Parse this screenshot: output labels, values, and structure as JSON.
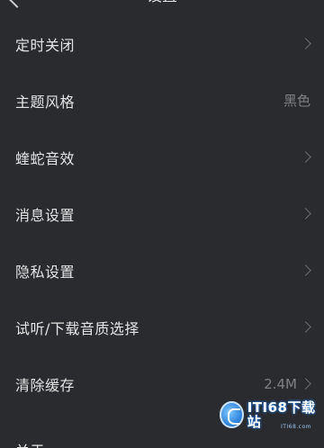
{
  "header": {
    "title": "设置",
    "back_icon": "chevron-left-icon"
  },
  "settings": {
    "items": [
      {
        "label": "定时关闭",
        "value": "",
        "icon": "chevron-right-icon"
      },
      {
        "label": "主题风格",
        "value": "黑色"
      },
      {
        "label": "蝰蛇音效",
        "value": "",
        "icon": "chevron-right-icon"
      },
      {
        "label": "消息设置",
        "value": "",
        "icon": "chevron-right-icon"
      },
      {
        "label": "隐私设置",
        "value": "",
        "icon": "chevron-right-icon"
      },
      {
        "label": "试听/下载音质选择",
        "value": "",
        "icon": "chevron-right-icon"
      },
      {
        "label": "清除缓存",
        "value": "2.4M",
        "icon": "chevron-right-icon"
      },
      {
        "label": "关于"
      }
    ]
  },
  "watermark": {
    "text": "ITI68下载站",
    "sub": "ITI68.com"
  },
  "colors": {
    "background": "#2a2b2f",
    "text": "#e4e4e4",
    "secondary_text": "#7f8086"
  }
}
